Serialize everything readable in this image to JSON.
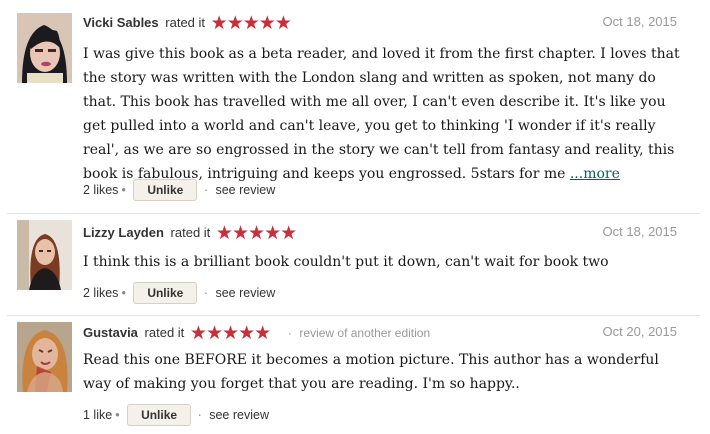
{
  "reviews": [
    {
      "user": "Vicki Sables",
      "rated_text": "rated it",
      "rating": 5,
      "edition_note": "",
      "date": "Oct 18, 2015",
      "text": "I was give this book as a beta reader, and loved it from the first chapter. I loves that the story was written with the London slang and written as spoken, not many do that. This book has travelled with me all over, I can't even describe it. It's like you get pulled into a world and can't leave, you get to thinking 'I wonder if it's really real', as we are so engrossed in the story we can't tell from fantasy and reality, this book is fabulous, intriguing and keeps you engrossed. 5stars for me",
      "more_label": "...more",
      "likes": "2 likes",
      "unlike_label": "Unlike",
      "see_review_label": "see review"
    },
    {
      "user": "Lizzy Layden",
      "rated_text": "rated it",
      "rating": 5,
      "edition_note": "",
      "date": "Oct 18, 2015",
      "text": "I think this is a brilliant book couldn't put it down, can't wait for book two",
      "more_label": "",
      "likes": "2 likes",
      "unlike_label": "Unlike",
      "see_review_label": "see review"
    },
    {
      "user": "Gustavia",
      "rated_text": "rated it",
      "rating": 5,
      "edition_note": "review of another edition",
      "date": "Oct 20, 2015",
      "text": "Read this one BEFORE it becomes a motion picture. This author has a wonderful way of making you forget that you are reading. I'm so happy..",
      "more_label": "",
      "likes": "1 like",
      "unlike_label": "Unlike",
      "see_review_label": "see review"
    }
  ],
  "colors": {
    "star": "#c7303a",
    "link": "#00635d",
    "muted": "#999999",
    "button_bg": "#f4f1ea"
  },
  "icons": {
    "star": "★",
    "separator": "·",
    "bullet": "•"
  }
}
